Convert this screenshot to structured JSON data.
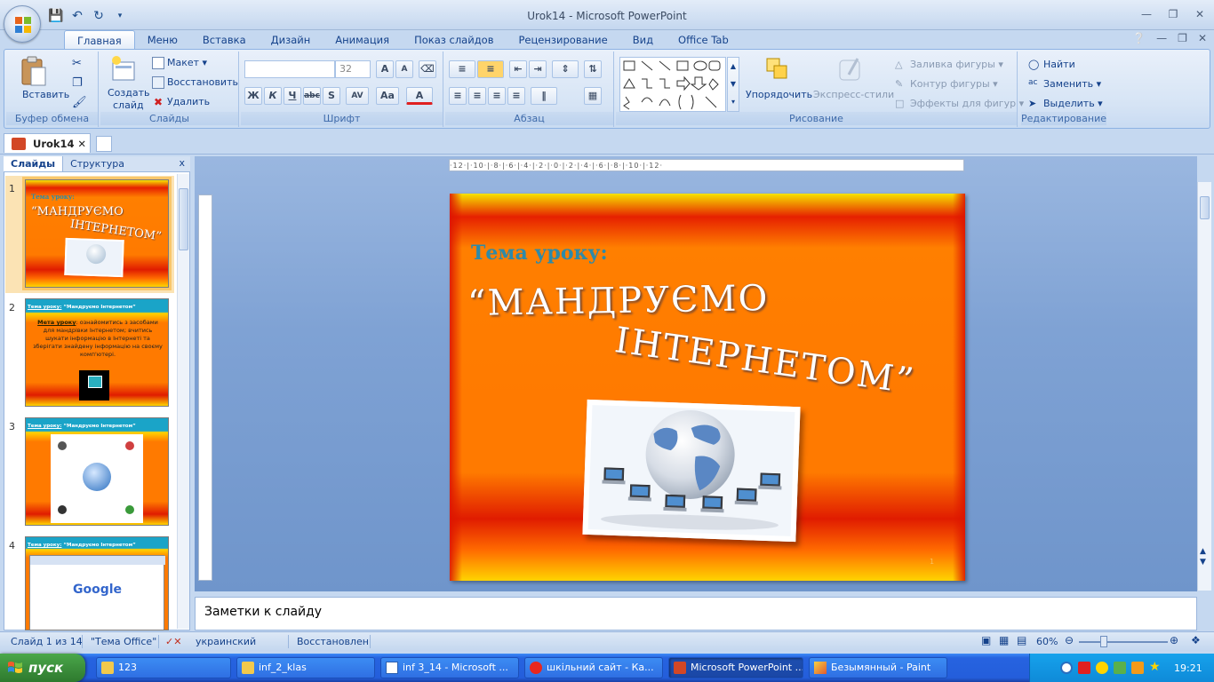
{
  "window": {
    "title": "Urok14  -  Microsoft PowerPoint"
  },
  "ribbon_tabs": [
    "Главная",
    "Меню",
    "Вставка",
    "Дизайн",
    "Анимация",
    "Показ слайдов",
    "Рецензирование",
    "Вид",
    "Office Tab"
  ],
  "active_tab": "Главная",
  "groups": {
    "clipboard": {
      "label": "Буфер обмена",
      "paste": "Вставить"
    },
    "slides": {
      "label": "Слайды",
      "new_slide_1": "Создать",
      "new_slide_2": "слайд",
      "layout": "Макет",
      "reset": "Восстановить",
      "delete": "Удалить"
    },
    "font": {
      "label": "Шрифт",
      "size": "32",
      "bold": "Ж",
      "italic": "К",
      "underline": "Ч",
      "strike": "abc",
      "shadow": "S",
      "spacing": "AV",
      "case": "Aa",
      "color": "A"
    },
    "paragraph": {
      "label": "Абзац"
    },
    "drawing": {
      "label": "Рисование",
      "arrange": "Упорядочить",
      "quick_styles": "Экспресс-стили",
      "fill": "Заливка фигуры",
      "outline": "Контур фигуры",
      "effects": "Эффекты для фигур"
    },
    "editing": {
      "label": "Редактирование",
      "find": "Найти",
      "replace": "Заменить",
      "select": "Выделить"
    }
  },
  "doc_tab": {
    "name": "Urok14"
  },
  "panel": {
    "tab_slides": "Слайды",
    "tab_outline": "Структура",
    "close": "x"
  },
  "thumbnails": [
    {
      "num": "1",
      "topic": "Тема уроку:",
      "title1": "“МАНДРУЄМО",
      "title2": "ІНТЕРНЕТОМ”"
    },
    {
      "num": "2",
      "header_a": "Тема уроку:",
      "header_b": "“Мандруємо  Інтернетом”",
      "goal_label": "Мета уроку",
      "goal_text": ": ознайомитись з засобами для мандрівки Інтернетом; вчитись шукати інформацію в Інтернеті та зберігати знайдену інформацію на своєму комп'ютері."
    },
    {
      "num": "3",
      "header_a": "Тема уроку:",
      "header_b": "“Мандруємо  Інтернетом”"
    },
    {
      "num": "4",
      "header_a": "Тема уроку:",
      "header_b": "“Мандруємо  Інтернетом”",
      "google": "Google"
    }
  ],
  "slide": {
    "topic": "Тема уроку:",
    "title_line1": "“МАНДРУЄМО",
    "title_line2": "ІНТЕРНЕТОМ”",
    "page_num": "1"
  },
  "ruler": {
    "h": "·12·|·10·|·8·|·6·|·4·|·2·|·0·|·2·|·4·|·6·|·8·|·10·|·12·"
  },
  "notes": {
    "placeholder": "Заметки к слайду"
  },
  "status": {
    "slide": "Слайд 1 из 14",
    "theme": "\"Тема Office\"",
    "lang": "украинский",
    "state": "Восстановлен",
    "zoom": "60%"
  },
  "taskbar": {
    "start": "пуск",
    "tasks": [
      "123",
      "inf_2_klas",
      "inf 3_14 - Microsoft ...",
      "шкільний сайт - Ка...",
      "Microsoft PowerPoint ...",
      "Безымянный - Paint"
    ],
    "lang": "RU",
    "time": "19:21"
  },
  "colors": {
    "accent": "#15428b",
    "slide_orange": "#ff7a00",
    "topic_teal": "#2e8aa8"
  }
}
